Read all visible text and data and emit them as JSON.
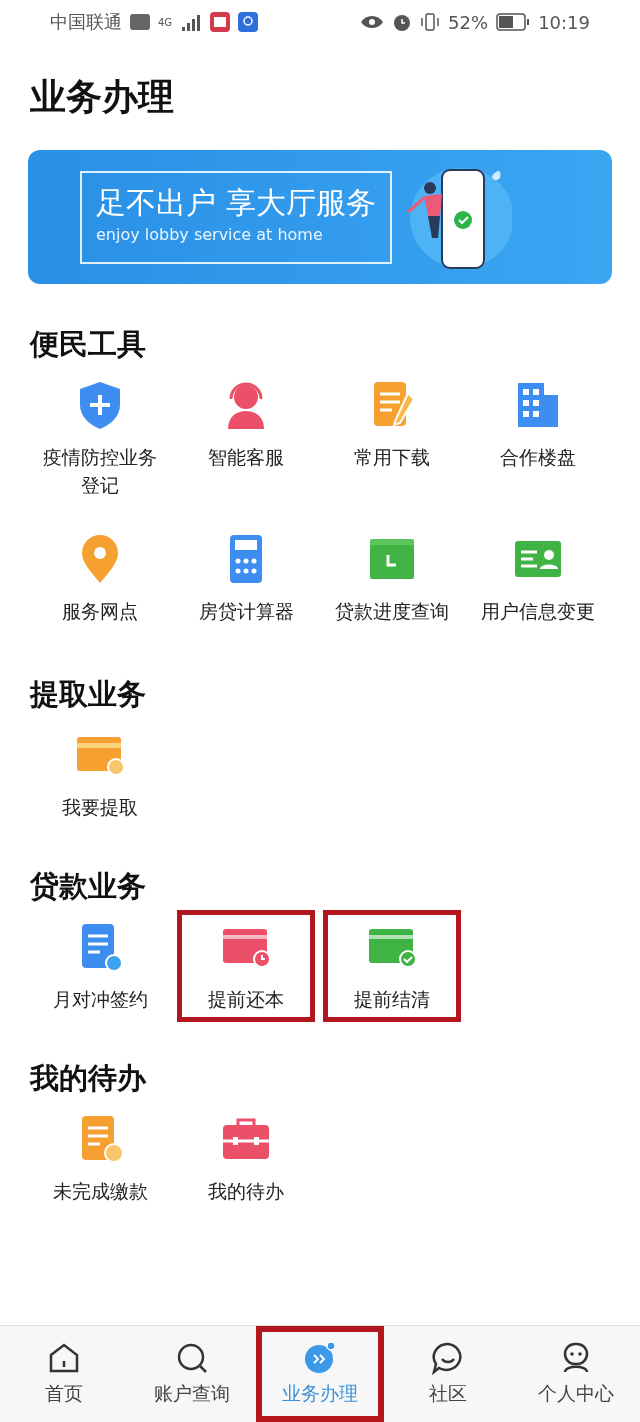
{
  "status_bar": {
    "carrier": "中国联通",
    "network": "4G",
    "battery": "52%",
    "time": "10:19"
  },
  "page_title": "业务办理",
  "banner": {
    "title": "足不出户 享大厅服务",
    "subtitle": "enjoy lobby service at home"
  },
  "sections": [
    {
      "title": "便民工具",
      "items": [
        {
          "label": "疫情防控业务登记",
          "highlighted": false
        },
        {
          "label": "智能客服",
          "highlighted": false
        },
        {
          "label": "常用下载",
          "highlighted": false
        },
        {
          "label": "合作楼盘",
          "highlighted": false
        },
        {
          "label": "服务网点",
          "highlighted": false
        },
        {
          "label": "房贷计算器",
          "highlighted": false
        },
        {
          "label": "贷款进度查询",
          "highlighted": false
        },
        {
          "label": "用户信息变更",
          "highlighted": false
        }
      ]
    },
    {
      "title": "提取业务",
      "items": [
        {
          "label": "我要提取",
          "highlighted": false
        }
      ]
    },
    {
      "title": "贷款业务",
      "items": [
        {
          "label": "月对冲签约",
          "highlighted": false
        },
        {
          "label": "提前还本",
          "highlighted": true
        },
        {
          "label": "提前结清",
          "highlighted": true
        }
      ]
    },
    {
      "title": "我的待办",
      "items": [
        {
          "label": "未完成缴款",
          "highlighted": false
        },
        {
          "label": "我的待办",
          "highlighted": false
        }
      ]
    }
  ],
  "tab_bar": [
    {
      "label": "首页",
      "selected": false,
      "highlighted": false
    },
    {
      "label": "账户查询",
      "selected": false,
      "highlighted": false
    },
    {
      "label": "业务办理",
      "selected": true,
      "highlighted": true
    },
    {
      "label": "社区",
      "selected": false,
      "highlighted": false
    },
    {
      "label": "个人中心",
      "selected": false,
      "highlighted": false
    }
  ]
}
